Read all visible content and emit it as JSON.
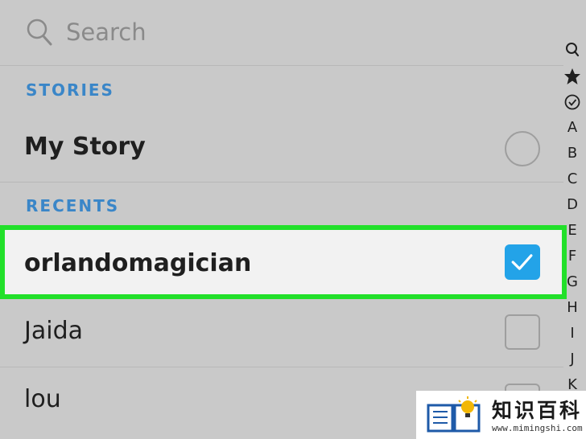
{
  "search": {
    "placeholder": "Search"
  },
  "sections": {
    "stories": "STORIES",
    "recents": "RECENTS"
  },
  "stories": [
    {
      "label": "My Story",
      "checked": false
    }
  ],
  "recents": [
    {
      "label": "orlandomagician",
      "checked": true,
      "highlighted": true
    },
    {
      "label": "Jaida",
      "checked": false
    },
    {
      "label": "lou",
      "checked": false
    }
  ],
  "index_bar": {
    "icons": [
      "search-icon",
      "star-icon",
      "check-circle-icon"
    ],
    "letters": [
      "A",
      "B",
      "C",
      "D",
      "E",
      "F",
      "G",
      "H",
      "I",
      "J",
      "K"
    ]
  },
  "watermark": {
    "title": "知识百科",
    "url": "www.mimingshi.com"
  },
  "colors": {
    "background": "#c9c9c9",
    "section_header": "#3a86c8",
    "checkbox_checked": "#23a3e8",
    "highlight_border": "#22e02a"
  }
}
